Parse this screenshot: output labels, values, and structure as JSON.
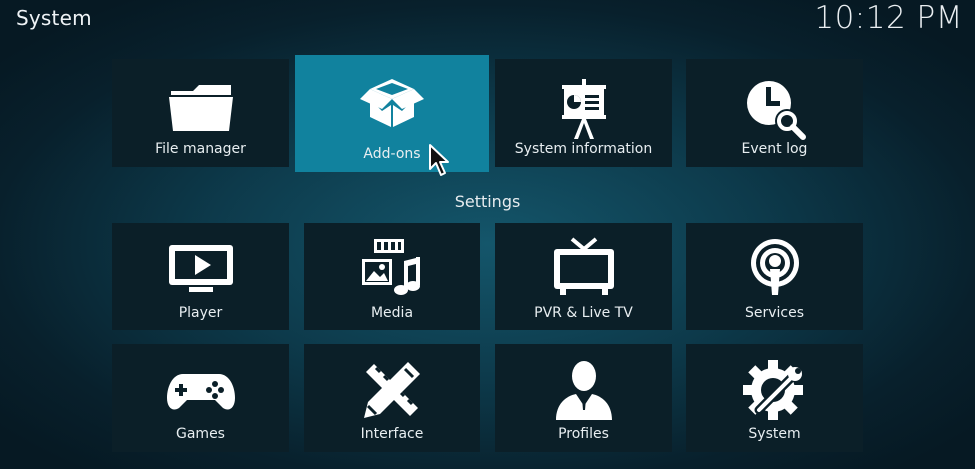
{
  "header": {
    "title": "System",
    "clock": "10:12 PM"
  },
  "section": {
    "settings_label": "Settings"
  },
  "top_row": [
    {
      "label": "File manager",
      "icon": "folder-icon"
    },
    {
      "label": "Add-ons",
      "icon": "open-box-icon",
      "focused": true
    },
    {
      "label": "System information",
      "icon": "presentation-board-icon"
    },
    {
      "label": "Event log",
      "icon": "clock-search-icon"
    }
  ],
  "settings_row1": [
    {
      "label": "Player",
      "icon": "tv-play-icon"
    },
    {
      "label": "Media",
      "icon": "media-icon"
    },
    {
      "label": "PVR & Live TV",
      "icon": "tv-antenna-icon"
    },
    {
      "label": "Services",
      "icon": "broadcast-icon"
    }
  ],
  "settings_row2": [
    {
      "label": "Games",
      "icon": "gamepad-icon"
    },
    {
      "label": "Interface",
      "icon": "pencil-ruler-icon"
    },
    {
      "label": "Profiles",
      "icon": "person-icon"
    },
    {
      "label": "System",
      "icon": "gear-tools-icon"
    }
  ],
  "colors": {
    "tile_bg": "#0b1f28",
    "focus_bg": "#11829e",
    "text": "#e8eef1"
  }
}
